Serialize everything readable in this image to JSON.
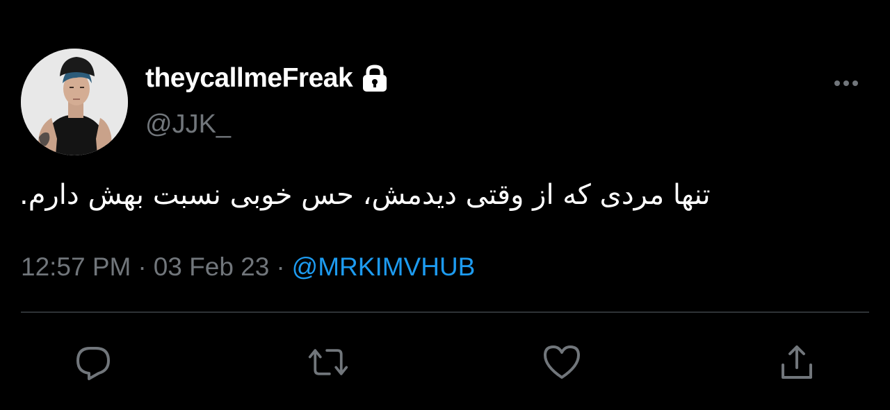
{
  "user": {
    "display_name": "theycallmeFreak",
    "handle": "@JJK_",
    "avatar_icon": "profile-photo",
    "protected_icon": "lock-icon"
  },
  "tweet": {
    "text": "تنها مردی که از وقتی دیدمش، حس خوبی نسبت بهش دارم.",
    "time": "12:57 PM",
    "date": "03 Feb 23",
    "separator": "·",
    "source": "@MRKIMVHUB"
  },
  "actions": [
    {
      "name": "reply",
      "icon": "reply-icon"
    },
    {
      "name": "retweet",
      "icon": "retweet-icon"
    },
    {
      "name": "like",
      "icon": "heart-icon"
    },
    {
      "name": "share",
      "icon": "share-icon"
    }
  ],
  "colors": {
    "background": "#000000",
    "text": "#ffffff",
    "secondary": "#71767b",
    "link": "#1d9bf0",
    "divider": "#2f3336"
  }
}
